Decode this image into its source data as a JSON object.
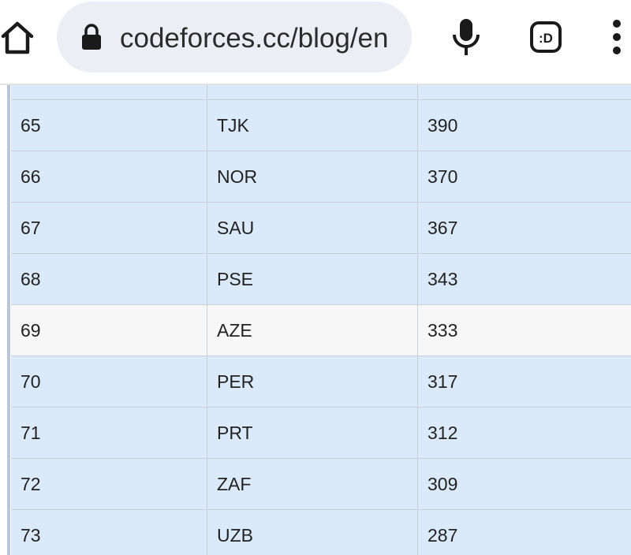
{
  "browser": {
    "url": "codeforces.cc/blog/en",
    "icons": {
      "home": "home-icon",
      "lock": "lock-icon",
      "mic": "microphone-icon",
      "extension": "tab-switcher-icon",
      "menu": "more-vert-icon"
    },
    "extension_label": ":D"
  },
  "table": {
    "rows": [
      {
        "rank": "",
        "country": "",
        "score": ""
      },
      {
        "rank": "65",
        "country": "TJK",
        "score": "390"
      },
      {
        "rank": "66",
        "country": "NOR",
        "score": "370"
      },
      {
        "rank": "67",
        "country": "SAU",
        "score": "367"
      },
      {
        "rank": "68",
        "country": "PSE",
        "score": "343"
      },
      {
        "rank": "69",
        "country": "AZE",
        "score": "333",
        "highlight": false
      },
      {
        "rank": "70",
        "country": "PER",
        "score": "317"
      },
      {
        "rank": "71",
        "country": "PRT",
        "score": "312"
      },
      {
        "rank": "72",
        "country": "ZAF",
        "score": "309"
      },
      {
        "rank": "73",
        "country": "UZB",
        "score": "287"
      }
    ]
  },
  "colors": {
    "row_bg": "#dbeafa",
    "row_alt_bg": "#f7f7f7",
    "grid": "#c8cfd8"
  }
}
